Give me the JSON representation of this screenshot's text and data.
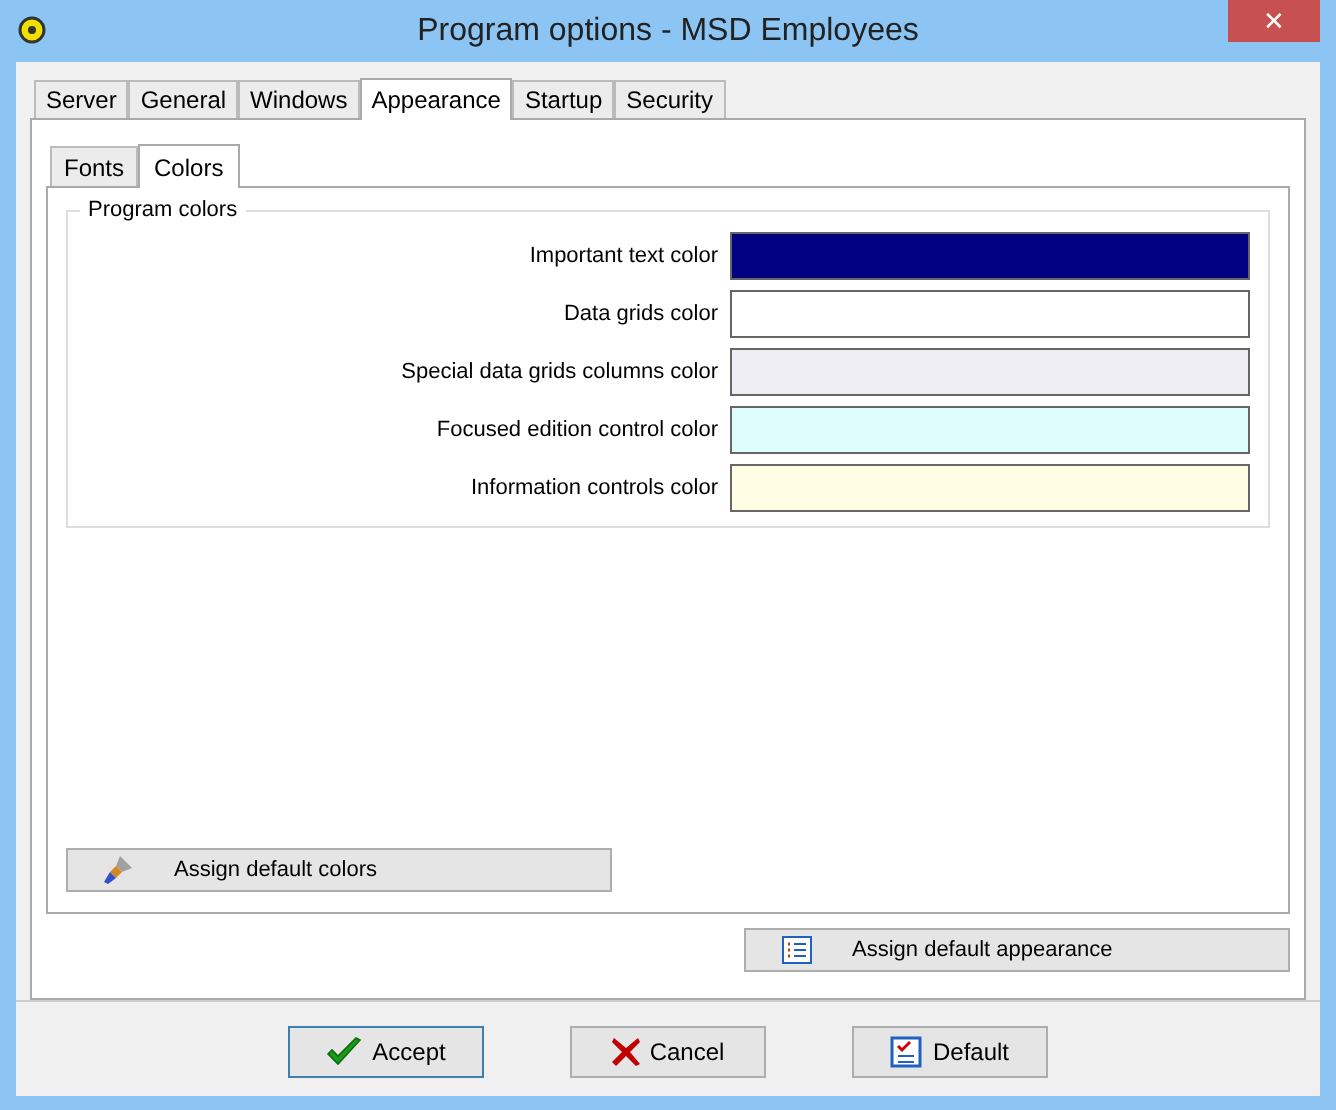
{
  "window": {
    "title": "Program options - MSD Employees",
    "close": "✕"
  },
  "tabs": [
    {
      "label": "Server",
      "selected": false
    },
    {
      "label": "General",
      "selected": false
    },
    {
      "label": "Windows",
      "selected": false
    },
    {
      "label": "Appearance",
      "selected": true
    },
    {
      "label": "Startup",
      "selected": false
    },
    {
      "label": "Security",
      "selected": false
    }
  ],
  "subtabs": [
    {
      "label": "Fonts",
      "selected": false
    },
    {
      "label": "Colors",
      "selected": true
    }
  ],
  "group": {
    "title": "Program colors",
    "rows": [
      {
        "label": "Important text color",
        "color": "#000080"
      },
      {
        "label": "Data grids color",
        "color": "#ffffff"
      },
      {
        "label": "Special data grids columns color",
        "color": "#f0eef5"
      },
      {
        "label": "Focused edition control color",
        "color": "#dffcfc"
      },
      {
        "label": "Information controls color",
        "color": "#fffde3"
      }
    ]
  },
  "assign_colors_button": "Assign default colors",
  "assign_appearance_button": "Assign default appearance",
  "buttons": [
    {
      "kind": "accept",
      "label": "Accept",
      "focused": true
    },
    {
      "kind": "cancel",
      "label": "Cancel",
      "focused": false
    },
    {
      "kind": "default",
      "label": "Default",
      "focused": false
    }
  ]
}
